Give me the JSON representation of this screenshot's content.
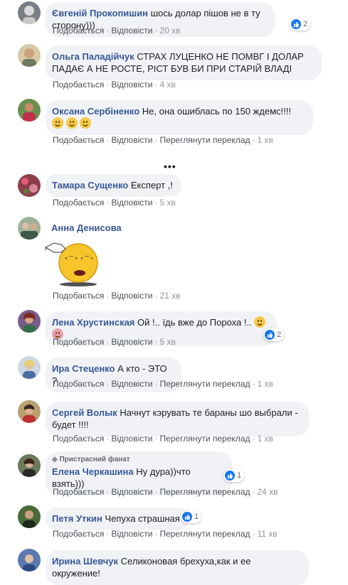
{
  "labels": {
    "like": "Подобається",
    "reply": "Відповісти",
    "see_translation": "Переглянути переклад"
  },
  "more_replies": "•••",
  "colors": {
    "author": "#385898",
    "bubble": "#f0f2f5",
    "like_blue": "#1877f2"
  },
  "comments": [
    {
      "author": "Євгеній Прокопишин",
      "text": "шось долар пішов не в ту сторону)))",
      "time": "20 хв",
      "reactions": "2"
    },
    {
      "author": "Ольга Паладійчук",
      "text": "СТРАХ ЛУЦЕНКО НЕ ПОМВГ І ДОЛАР ПАДАЄ А НЕ РОСТЕ, РІСТ БУВ БИ ПРИ СТАРІЙ ВЛАДІ",
      "time": "4 хв"
    },
    {
      "author": "Оксана Сербіненко",
      "text": "Не, она ошиблась по 150 ждемс!!!!",
      "time": "1 хв"
    },
    {
      "author": "Тамара Сущенко",
      "text": "Експерт ,!",
      "time": "5 хв"
    },
    {
      "author": "Анна Денисова",
      "text": "",
      "time": "21 хв"
    },
    {
      "author": "Лена Хрустинская",
      "text": "Ой !.. їдь вже до Пороха !..",
      "time": "5 хв",
      "reactions": "2"
    },
    {
      "author": "Ира Стеценко",
      "text": "А кто - ЭТО ?",
      "time": "1 хв"
    },
    {
      "author": "Сергей Волык",
      "text": "Начнут кэрувать те бараны шо выбрали - будет !!!!",
      "time": "1 хв"
    },
    {
      "author": "Елена Черкашина",
      "badge": "Пристрасний фанат",
      "text": "Ну дура))что взять)))",
      "time": "24 хв",
      "reactions": "1"
    },
    {
      "author": "Петя Уткин",
      "text": "Чепуха страшная",
      "time": "11 хв",
      "reactions": "1"
    },
    {
      "author": "Ирина Шевчук",
      "text": "Селиконовая брехуха,как и ее окружение!"
    }
  ]
}
